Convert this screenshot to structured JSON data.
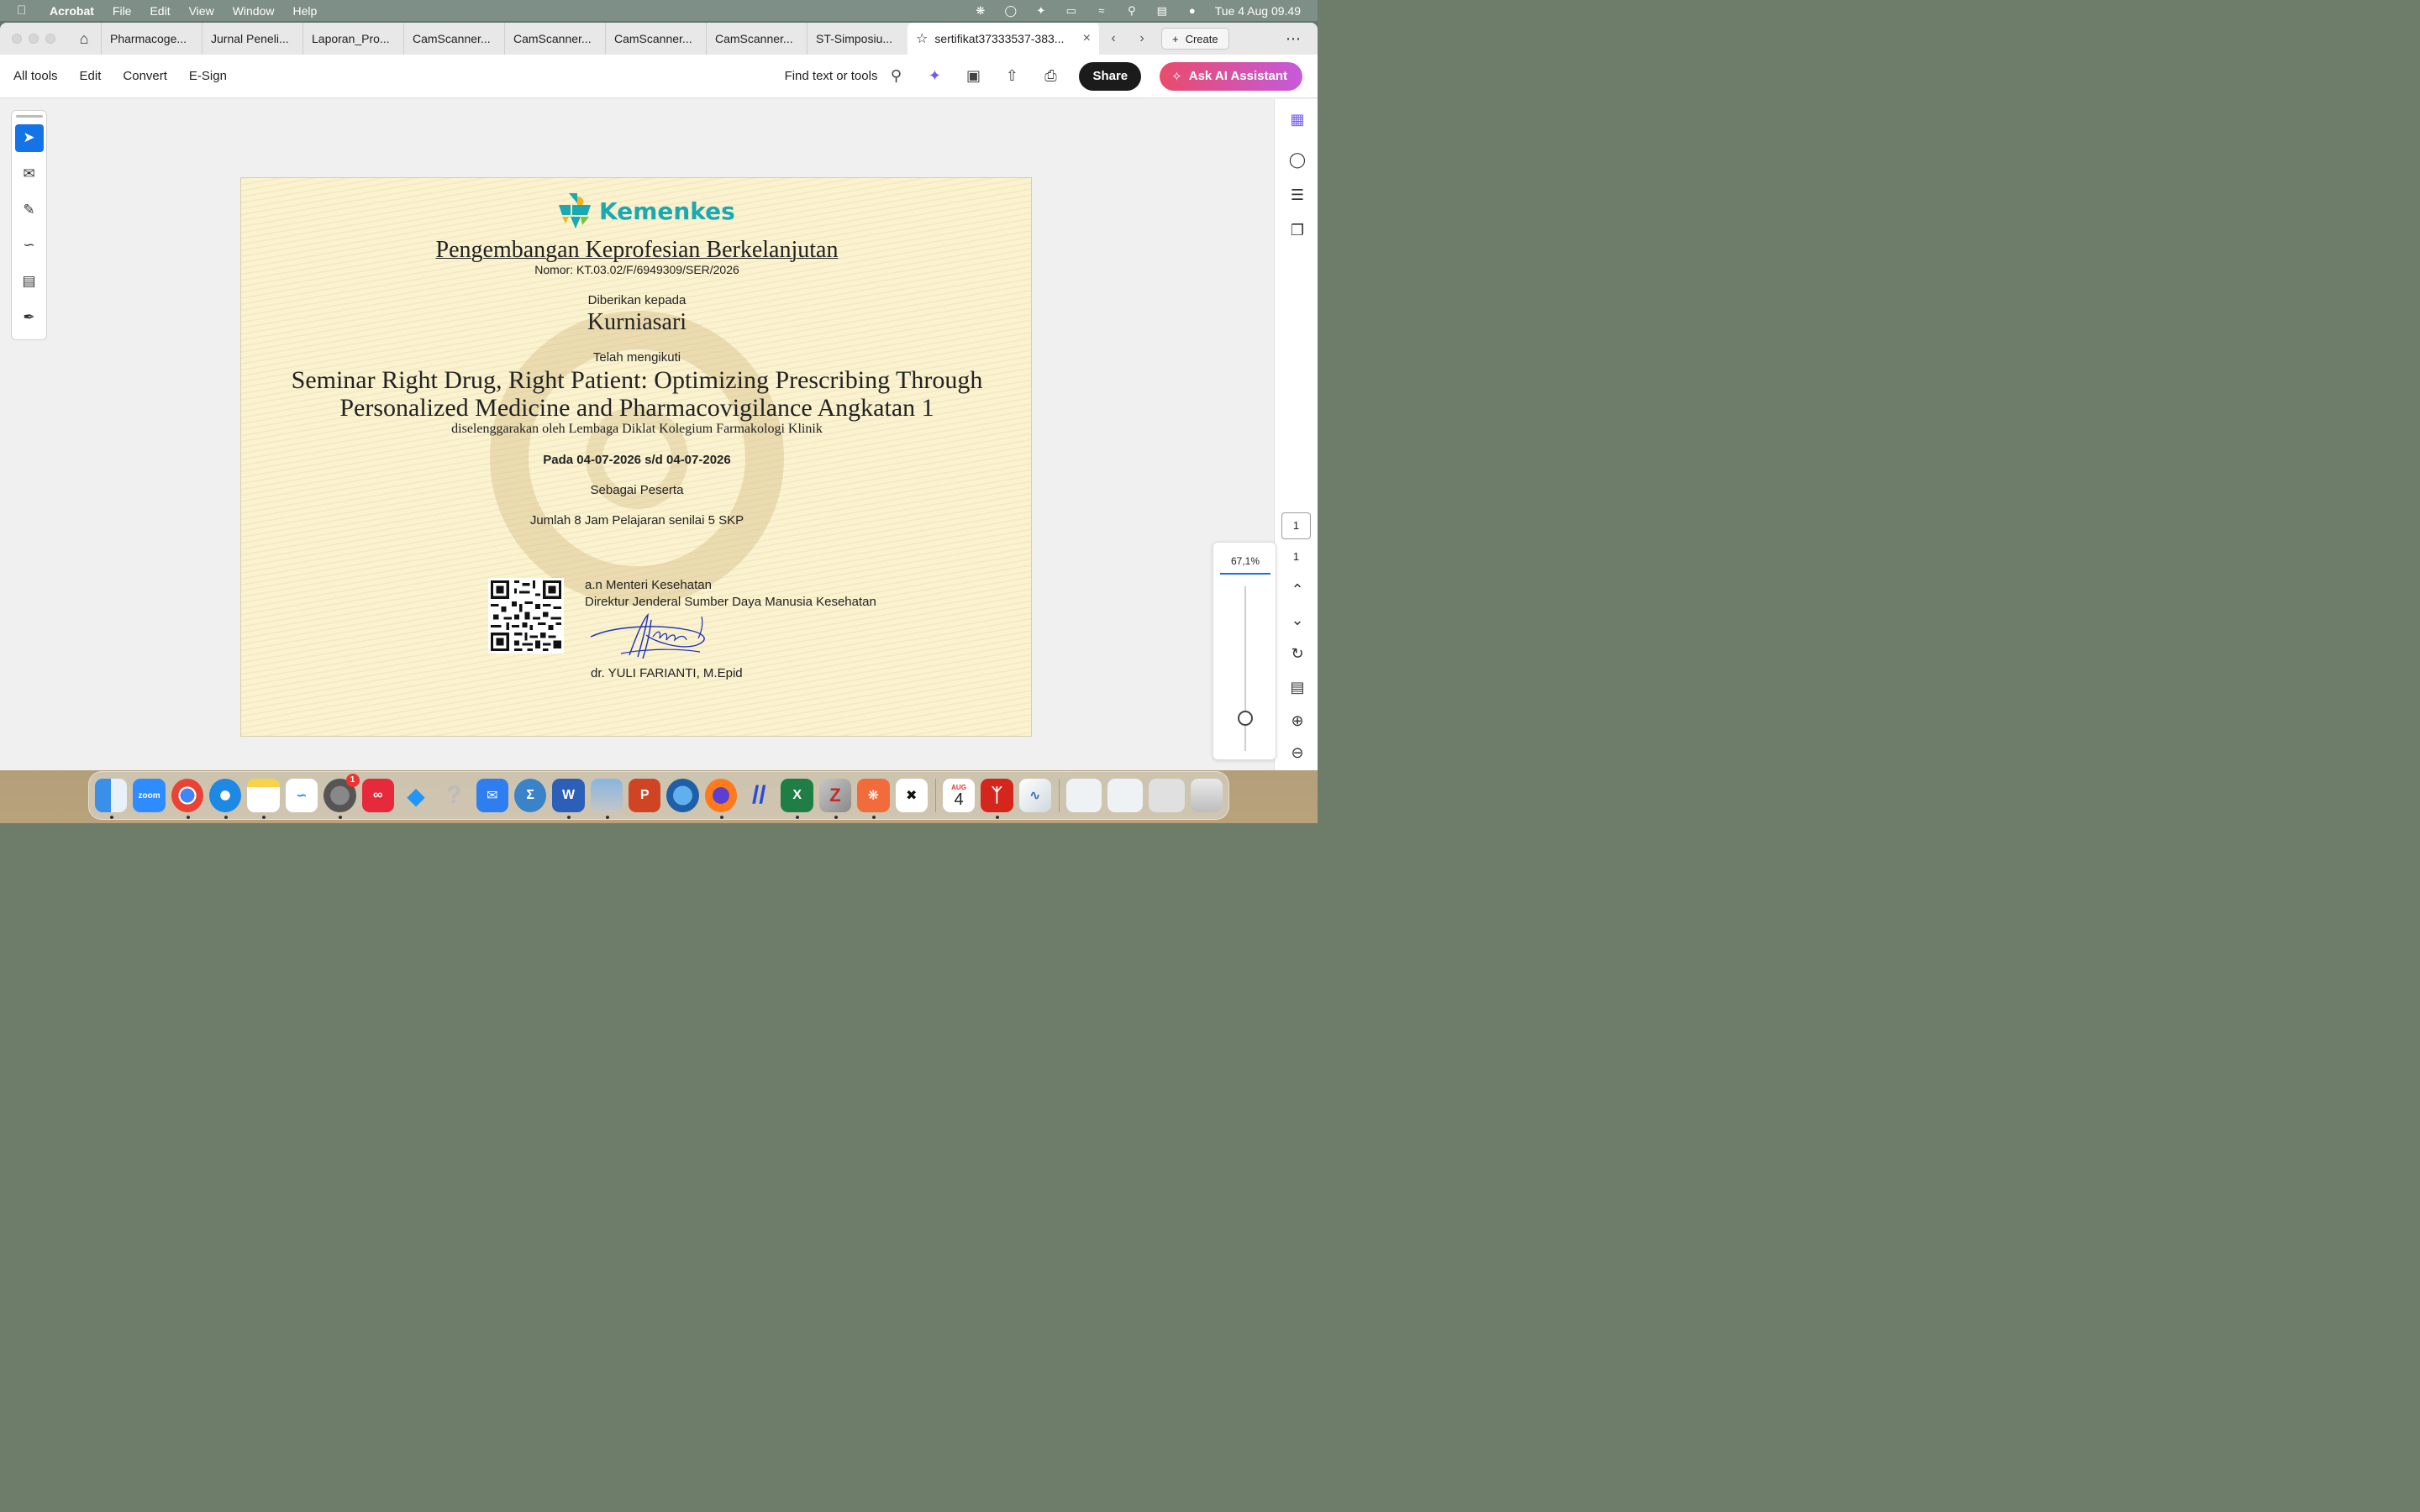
{
  "menubar": {
    "app_name": "Acrobat",
    "items": [
      "File",
      "Edit",
      "View",
      "Window",
      "Help"
    ],
    "datetime": "Tue 4 Aug  09.49"
  },
  "tabs": {
    "items": [
      "Pharmacoge...",
      "Jurnal Peneli...",
      "Laporan_Pro...",
      "CamScanner...",
      "CamScanner...",
      "CamScanner...",
      "CamScanner...",
      "ST-Simposiu..."
    ],
    "active": "sertifikat37333537-383...",
    "create_label": "Create"
  },
  "toolbar": {
    "menu": [
      "All tools",
      "Edit",
      "Convert",
      "E-Sign"
    ],
    "find_label": "Find text or tools",
    "share_label": "Share",
    "ai_label": "Ask AI Assistant"
  },
  "page_nav": {
    "current": "1",
    "total": "1"
  },
  "zoom": {
    "value": "67,1%",
    "slider_level": 0.2
  },
  "certificate": {
    "logo_text": "Kemenkes",
    "title": "Pengembangan Keprofesian Berkelanjutan",
    "nomor": "Nomor: KT.03.02/F/6949309/SER/2026",
    "given_to_label": "Diberikan kepada",
    "recipient": "Kurniasari",
    "attended_label": "Telah mengikuti",
    "seminar_line1": "Seminar Right Drug, Right Patient: Optimizing Prescribing Through",
    "seminar_line2": "Personalized Medicine and Pharmacovigilance Angkatan 1",
    "organizer": "diselenggarakan oleh Lembaga Diklat Kolegium Farmakologi Klinik",
    "date": "Pada 04-07-2026 s/d 04-07-2026",
    "role": "Sebagai Peserta",
    "hours": "Jumlah 8 Jam Pelajaran senilai 5 SKP",
    "sign_on_behalf": "a.n Menteri Kesehatan",
    "sign_position": "Direktur Jenderal Sumber Daya Manusia Kesehatan",
    "signer": "dr. YULI FARIANTI, M.Epid"
  },
  "dock": {
    "notification_badge": "1",
    "calendar_month": "AUG",
    "calendar_day": "4",
    "zoom_label": "zoom"
  },
  "colors": {
    "accent_blue": "#1473e6",
    "kemenkes_teal": "#1aa9b0",
    "certificate_bg": "#fbf3d0",
    "ai_gradient_start": "#e94b6b",
    "ai_gradient_end": "#c55adb"
  }
}
